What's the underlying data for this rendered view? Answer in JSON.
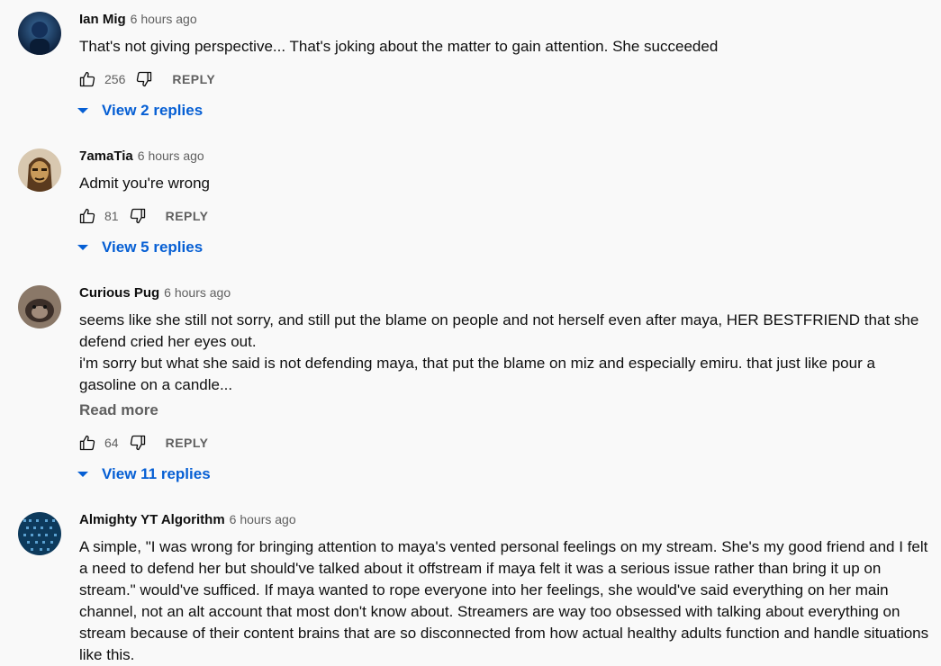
{
  "comments": [
    {
      "author": "Ian Mig",
      "time": "6 hours ago",
      "lines": [
        "That's not giving perspective... That's joking about the matter to gain attention. She succeeded"
      ],
      "likes": "256",
      "reply_label": "REPLY",
      "view_replies": "View 2 replies",
      "avatar_colors": [
        "#0b1e3a",
        "#3d6fa0"
      ]
    },
    {
      "author": "7amaTia",
      "time": "6 hours ago",
      "lines": [
        "Admit you're wrong"
      ],
      "likes": "81",
      "reply_label": "REPLY",
      "view_replies": "View 5 replies",
      "avatar_colors": [
        "#5a3a1e",
        "#c89a5a"
      ]
    },
    {
      "author": "Curious Pug",
      "time": "6 hours ago",
      "lines": [
        "seems like she still not sorry, and still put the blame on people and not herself even after maya, HER BESTFRIEND that she defend cried her eyes out.",
        "i'm sorry but what she said is not defending maya, that put the blame on miz and especially emiru. that just like pour a gasoline on a candle..."
      ],
      "read_more": "Read more",
      "likes": "64",
      "reply_label": "REPLY",
      "view_replies": "View 11 replies",
      "avatar_colors": [
        "#3b2e28",
        "#a08a7a"
      ]
    },
    {
      "author": "Almighty YT Algorithm",
      "time": "6 hours ago",
      "lines": [
        "A simple, \"I was wrong for bringing attention to maya's vented personal feelings on my stream. She's my good friend and I felt a need to defend her but should've talked about it offstream if maya felt it was a serious issue rather than bring it up on stream.\" would've sufficed. If maya wanted to rope everyone into her feelings, she would've said everything on her main channel, not an alt account that most don't know about. Streamers are way too obsessed with talking about everything on stream because of their content brains that are so disconnected from how actual healthy adults function and handle situations like this."
      ],
      "avatar_colors": [
        "#0d3a5c",
        "#5aa0d0"
      ]
    }
  ],
  "colors": {
    "background": "#f9f9f9",
    "link_blue": "#065fd4",
    "secondary_text": "#606060"
  },
  "icons": {
    "like": "thumbs-up-icon",
    "dislike": "thumbs-down-icon",
    "expand": "caret-down-icon"
  }
}
